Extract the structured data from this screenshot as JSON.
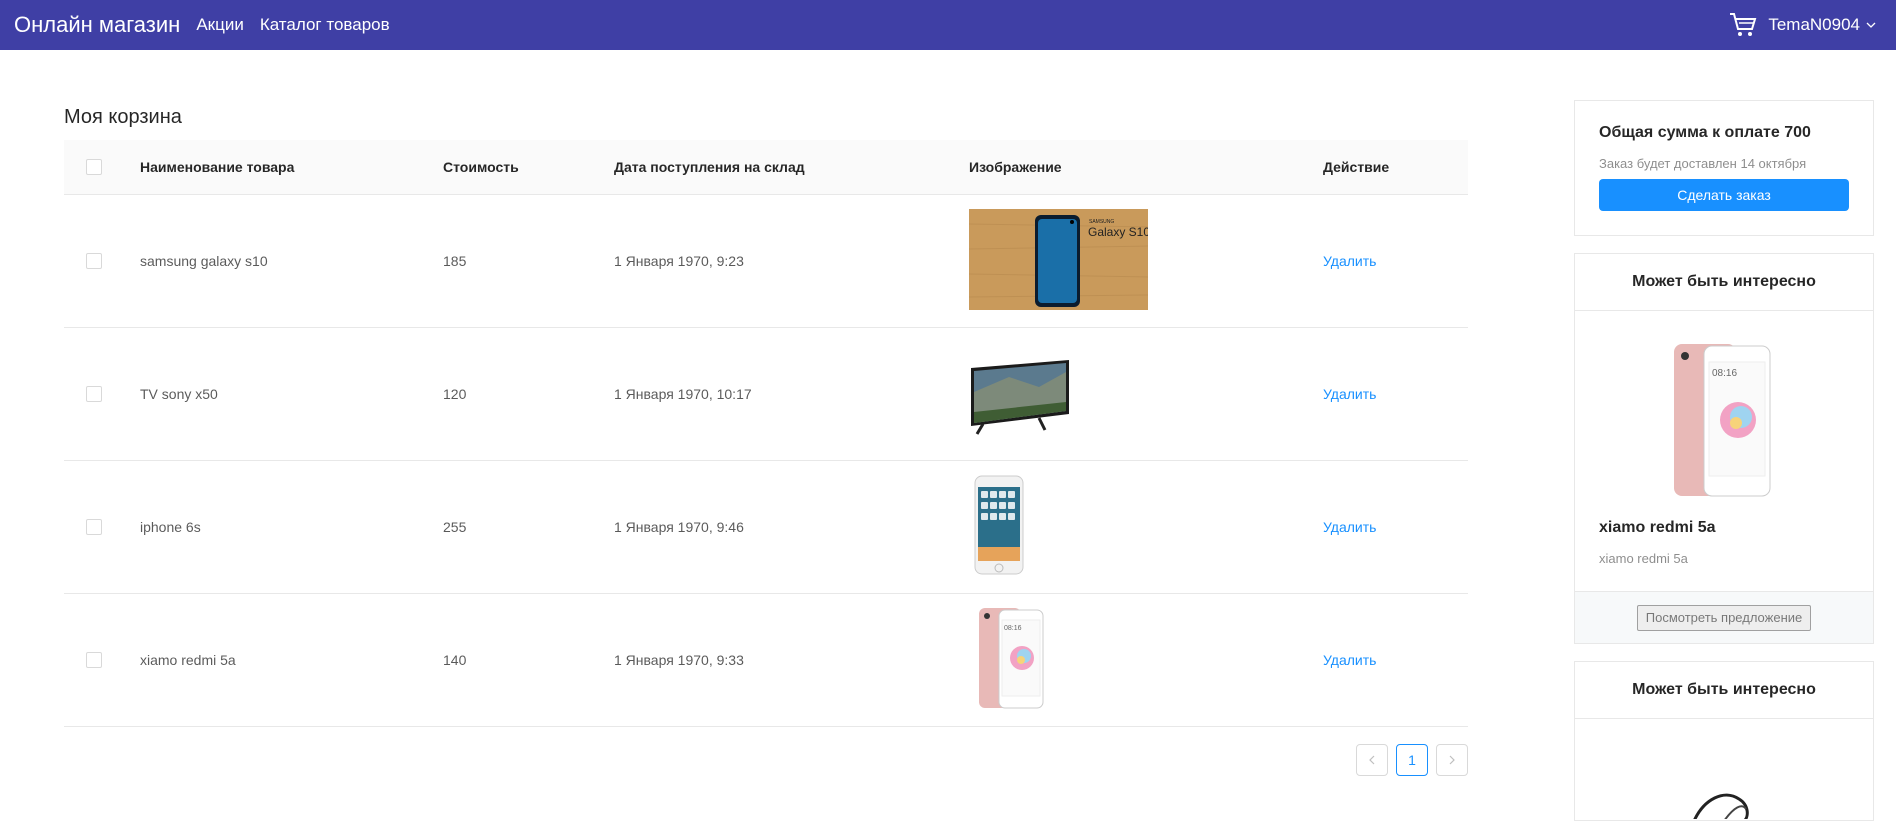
{
  "header": {
    "brand": "Онлайн магазин",
    "nav": [
      "Акции",
      "Каталог товаров"
    ],
    "username": "TemaN0904",
    "accent": "#3f3fa5"
  },
  "cart": {
    "title": "Моя корзина",
    "columns": [
      "Наименование товара",
      "Стоимость",
      "Дата поступления на склад",
      "Изображение",
      "Действие"
    ],
    "rows": [
      {
        "name": "samsung galaxy s10",
        "price": "185",
        "date": "1 Января 1970, 9:23",
        "image": "samsung-galaxy-s10-image",
        "action": "Удалить"
      },
      {
        "name": "TV sony x50",
        "price": "120",
        "date": "1 Января 1970, 10:17",
        "image": "sony-tv-image",
        "action": "Удалить"
      },
      {
        "name": "iphone 6s",
        "price": "255",
        "date": "1 Января 1970, 9:46",
        "image": "iphone-image",
        "action": "Удалить"
      },
      {
        "name": "xiamo redmi 5a",
        "price": "140",
        "date": "1 Января 1970, 9:33",
        "image": "redmi-image",
        "action": "Удалить"
      }
    ],
    "pagination": {
      "current": "1"
    }
  },
  "summary": {
    "title": "Общая сумма к оплате 700",
    "delivery": "Заказ будет доставлен 14 октября",
    "order_button": "Сделать заказ"
  },
  "recommendations": [
    {
      "title": "Может быть интересно",
      "name": "xiamo redmi 5a",
      "desc": "xiamo redmi 5a",
      "button": "Посмотреть предложение"
    },
    {
      "title": "Может быть интересно"
    }
  ]
}
